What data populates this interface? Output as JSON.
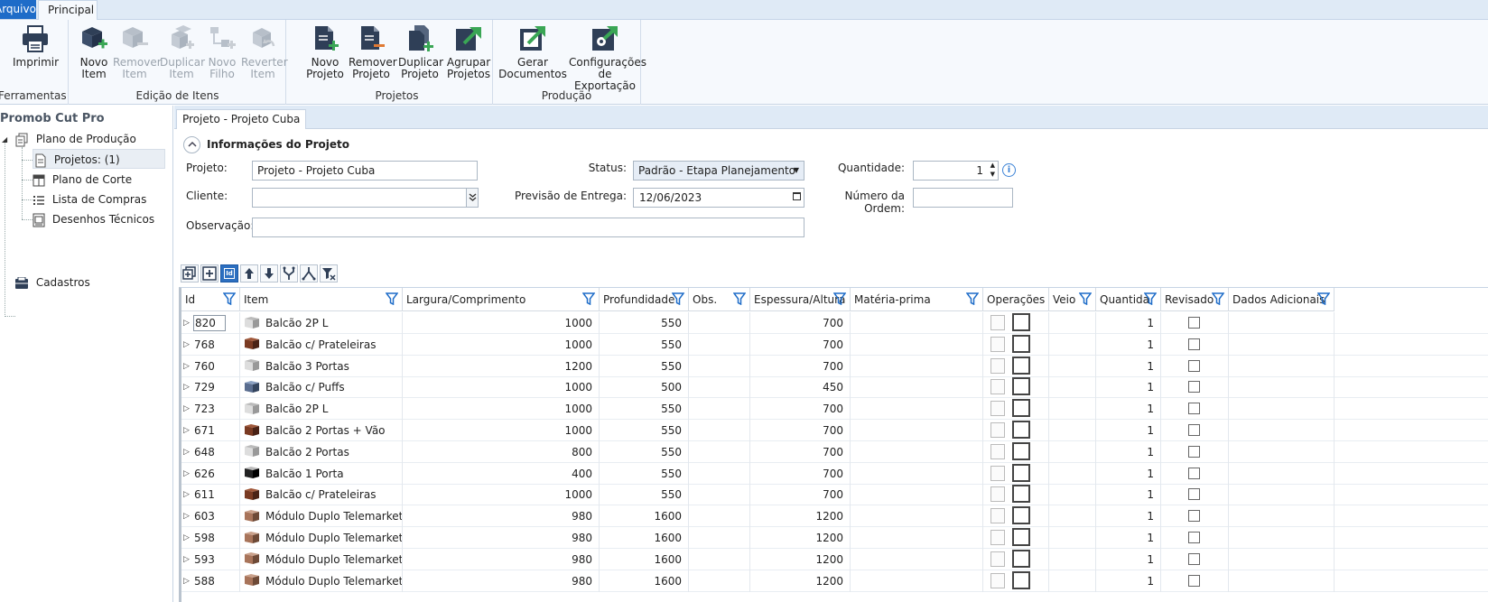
{
  "ribbon": {
    "tabs": [
      {
        "label": "Arquivo"
      },
      {
        "label": "Principal"
      }
    ],
    "groups": {
      "ferramentas": {
        "label": "Ferramentas",
        "buttons": [
          {
            "label1": "Imprimir",
            "label2": ""
          }
        ]
      },
      "edicao": {
        "label": "Edição de Itens",
        "buttons": [
          {
            "label1": "Novo",
            "label2": "Item"
          },
          {
            "label1": "Remover",
            "label2": "Item"
          },
          {
            "label1": "Duplicar",
            "label2": "Item"
          },
          {
            "label1": "Novo",
            "label2": "Filho"
          },
          {
            "label1": "Reverter",
            "label2": "Item"
          }
        ]
      },
      "projetos": {
        "label": "Projetos",
        "buttons": [
          {
            "label1": "Novo",
            "label2": "Projeto"
          },
          {
            "label1": "Remover",
            "label2": "Projeto"
          },
          {
            "label1": "Duplicar",
            "label2": "Projeto"
          },
          {
            "label1": "Agrupar",
            "label2": "Projetos"
          }
        ]
      },
      "producao": {
        "label": "Produção",
        "buttons": [
          {
            "label1": "Gerar",
            "label2": "Documentos"
          },
          {
            "label1": "Configurações",
            "label2": "de Exportação"
          }
        ]
      }
    }
  },
  "sidebar": {
    "title": "Promob Cut Pro",
    "items": [
      {
        "label": "Plano de Produção"
      },
      {
        "label": "Projetos: (1)"
      },
      {
        "label": "Plano de Corte"
      },
      {
        "label": "Lista de Compras"
      },
      {
        "label": "Desenhos Técnicos"
      },
      {
        "label": "Cadastros"
      }
    ]
  },
  "document": {
    "tab": "Projeto - Projeto Cuba",
    "section_title": "Informações do Projeto",
    "fields": {
      "projeto": {
        "label": "Projeto:",
        "value": "Projeto - Projeto Cuba"
      },
      "status": {
        "label": "Status:",
        "value": "Padrão - Etapa Planejamento"
      },
      "quantidade": {
        "label": "Quantidade:",
        "value": "1"
      },
      "cliente": {
        "label": "Cliente:",
        "value": ""
      },
      "previsao": {
        "label": "Previsão de Entrega:",
        "value": "12/06/2023"
      },
      "numero_ordem": {
        "label": "Número da Ordem:",
        "value": ""
      },
      "observacao": {
        "label": "Observação:",
        "value": ""
      }
    },
    "grid_tools": {
      "id_label": "Id"
    }
  },
  "grid": {
    "columns": [
      "Id",
      "Item",
      "Largura/Comprimento",
      "Profundidade",
      "Obs.",
      "Espessura/Altura",
      "Matéria-prima",
      "Operações",
      "Veio",
      "Quantida",
      "Revisado",
      "Dados Adicionais"
    ],
    "rows": [
      {
        "id": "820",
        "item": "Balcão 2P L",
        "largura": "1000",
        "profundidade": "550",
        "obs": "",
        "espessura": "700",
        "materia": "",
        "veio": "",
        "quantidade": "1",
        "thumb": "light"
      },
      {
        "id": "768",
        "item": "Balcão c/ Prateleiras",
        "largura": "1000",
        "profundidade": "550",
        "obs": "",
        "espessura": "700",
        "materia": "",
        "veio": "",
        "quantidade": "1",
        "thumb": "wood"
      },
      {
        "id": "760",
        "item": "Balcão 3 Portas",
        "largura": "1200",
        "profundidade": "550",
        "obs": "",
        "espessura": "700",
        "materia": "",
        "veio": "",
        "quantidade": "1",
        "thumb": "light"
      },
      {
        "id": "729",
        "item": "Balcão c/ Puffs",
        "largura": "1000",
        "profundidade": "500",
        "obs": "",
        "espessura": "450",
        "materia": "",
        "veio": "",
        "quantidade": "1",
        "thumb": "blue"
      },
      {
        "id": "723",
        "item": "Balcão 2P L",
        "largura": "1000",
        "profundidade": "550",
        "obs": "",
        "espessura": "700",
        "materia": "",
        "veio": "",
        "quantidade": "1",
        "thumb": "light"
      },
      {
        "id": "671",
        "item": "Balcão 2 Portas + Vão",
        "largura": "1000",
        "profundidade": "550",
        "obs": "",
        "espessura": "700",
        "materia": "",
        "veio": "",
        "quantidade": "1",
        "thumb": "wood"
      },
      {
        "id": "648",
        "item": "Balcão 2 Portas",
        "largura": "800",
        "profundidade": "550",
        "obs": "",
        "espessura": "700",
        "materia": "",
        "veio": "",
        "quantidade": "1",
        "thumb": "light"
      },
      {
        "id": "626",
        "item": "Balcão 1 Porta",
        "largura": "400",
        "profundidade": "550",
        "obs": "",
        "espessura": "700",
        "materia": "",
        "veio": "",
        "quantidade": "1",
        "thumb": "dark"
      },
      {
        "id": "611",
        "item": "Balcão c/ Prateleiras",
        "largura": "1000",
        "profundidade": "550",
        "obs": "",
        "espessura": "700",
        "materia": "",
        "veio": "",
        "quantidade": "1",
        "thumb": "wood"
      },
      {
        "id": "603",
        "item": "Módulo Duplo Telemarketing",
        "largura": "980",
        "profundidade": "1600",
        "obs": "",
        "espessura": "1200",
        "materia": "",
        "veio": "",
        "quantidade": "1",
        "thumb": "desk"
      },
      {
        "id": "598",
        "item": "Módulo Duplo Telemarketing",
        "largura": "980",
        "profundidade": "1600",
        "obs": "",
        "espessura": "1200",
        "materia": "",
        "veio": "",
        "quantidade": "1",
        "thumb": "desk"
      },
      {
        "id": "593",
        "item": "Módulo Duplo Telemarketing",
        "largura": "980",
        "profundidade": "1600",
        "obs": "",
        "espessura": "1200",
        "materia": "",
        "veio": "",
        "quantidade": "1",
        "thumb": "desk"
      },
      {
        "id": "588",
        "item": "Módulo Duplo Telemarketing",
        "largura": "980",
        "profundidade": "1600",
        "obs": "",
        "espessura": "1200",
        "materia": "",
        "veio": "",
        "quantidade": "1",
        "thumb": "desk"
      }
    ]
  },
  "colors": {
    "accent": "#1e6cc8",
    "ribbon_bg": "#f6f9fd",
    "tab_bar": "#dfeaf6",
    "icon_dark": "#2f3f57",
    "icon_green": "#3aa655",
    "icon_red": "#d9534f"
  }
}
